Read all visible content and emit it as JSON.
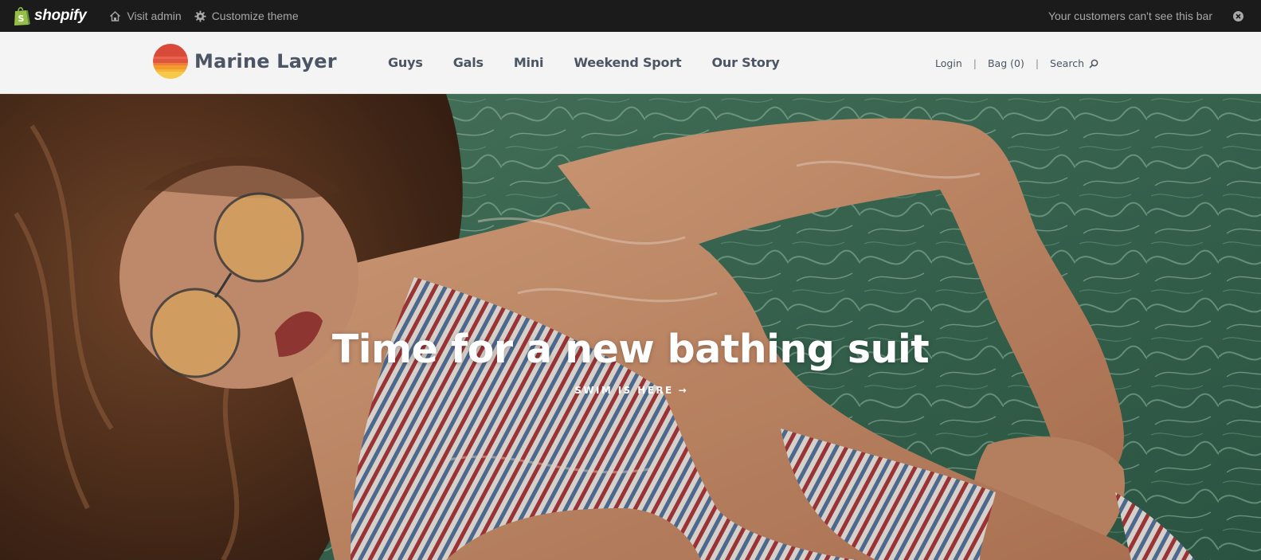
{
  "admin_bar": {
    "brand": "shopify",
    "visit_admin": "Visit admin",
    "customize_theme": "Customize theme",
    "notice": "Your customers can't see this bar"
  },
  "header": {
    "brand_name": "Marine Layer",
    "nav": [
      "Guys",
      "Gals",
      "Mini",
      "Weekend Sport",
      "Our Story"
    ],
    "login": "Login",
    "separator": "|",
    "bag": "Bag (0)",
    "search": "Search"
  },
  "hero": {
    "title": "Time for a new bathing suit",
    "cta": "SWIM IS HERE",
    "cta_arrow": "→"
  },
  "colors": {
    "admin_bg": "#1b1b1b",
    "shopify_green": "#95bf47",
    "header_bg": "#f4f4f4",
    "nav_text": "#4b5563",
    "logo_red": "#d94a3a",
    "logo_orange": "#f39a2d",
    "logo_yellow": "#f6c94a",
    "water": "#3e6c55",
    "skin": "#c98f6b",
    "stripe_red": "#a8383a",
    "stripe_blue": "#54719a"
  },
  "icons": {
    "shopify": "shopify-bag-icon",
    "visit_admin": "home-icon",
    "customize": "gear-icon",
    "close": "close-icon",
    "search": "search-icon"
  }
}
